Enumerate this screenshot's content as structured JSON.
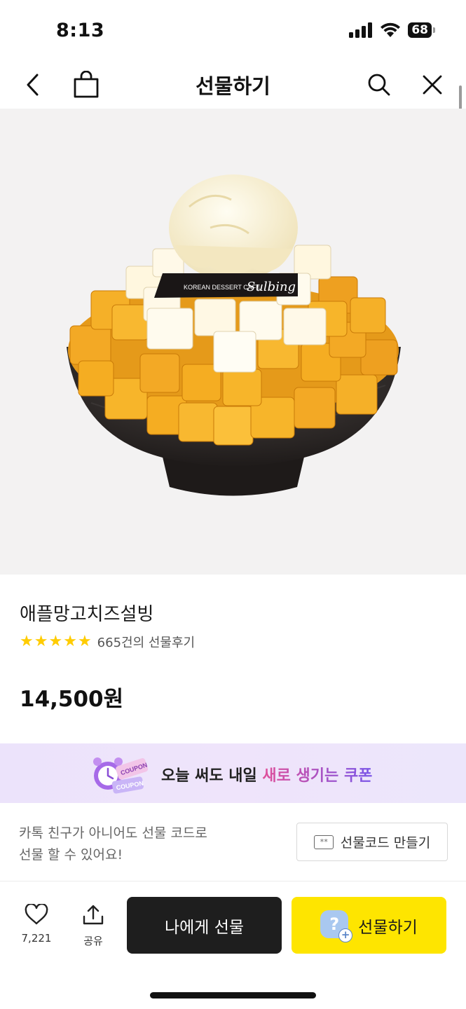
{
  "status_bar": {
    "time": "8:13",
    "battery": "68"
  },
  "nav": {
    "title": "선물하기"
  },
  "product": {
    "name": "애플망고치즈설빙",
    "rating_stars": 5,
    "review_count_text": "665건의 선물후기",
    "price": "14,500원",
    "image_brand_text": "KOREAN DESSERT CAFE",
    "image_brand_logo": "Sulbing"
  },
  "coupon_banner": {
    "text_prefix": "오늘 써도 내일 ",
    "text_highlight": "새로 생기는 쿠폰",
    "tag_text": "COUPON"
  },
  "gift_code": {
    "description_line1": "카톡 친구가 아니어도 선물 코드로",
    "description_line2": "선물 할 수 있어요!",
    "button_icon_text": "**",
    "button_label": "선물코드 만들기"
  },
  "actions": {
    "like_count": "7,221",
    "share_label": "공유",
    "self_gift_label": "나에게 선물",
    "gift_label": "선물하기"
  },
  "colors": {
    "kakao_yellow": "#fee500",
    "dark_button": "#1e1e1e",
    "star": "#ffcc00",
    "banner_bg": "#ece3fb"
  }
}
